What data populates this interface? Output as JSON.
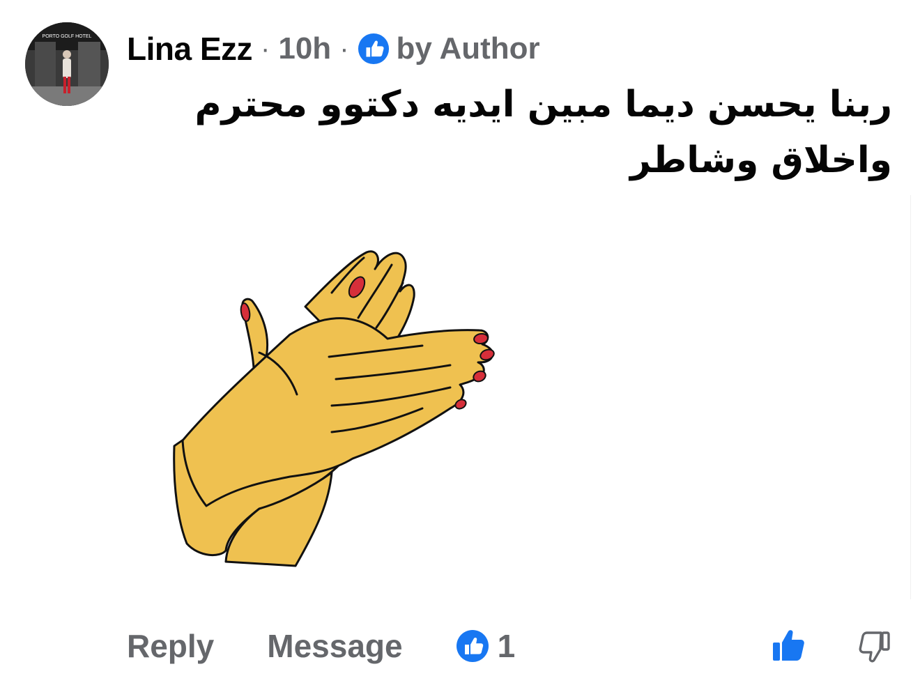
{
  "comment": {
    "author": "Lina Ezz",
    "separator": "·",
    "time": "10h",
    "liked_by": "by Author",
    "text": "ربنا يحسن ديما مبين ايديه دكتوو محترم واخلاق وشاطر",
    "avatar_sign_text": "PORTO GOLF HOTEL",
    "sticker": "clapping-hands-sticker"
  },
  "actions": {
    "reply_label": "Reply",
    "message_label": "Message",
    "reaction_count": "1"
  },
  "colors": {
    "accent": "#1877f2",
    "text_primary": "#050505",
    "text_secondary": "#65676b",
    "skin": "#efc150",
    "nail": "#d62f3a"
  }
}
